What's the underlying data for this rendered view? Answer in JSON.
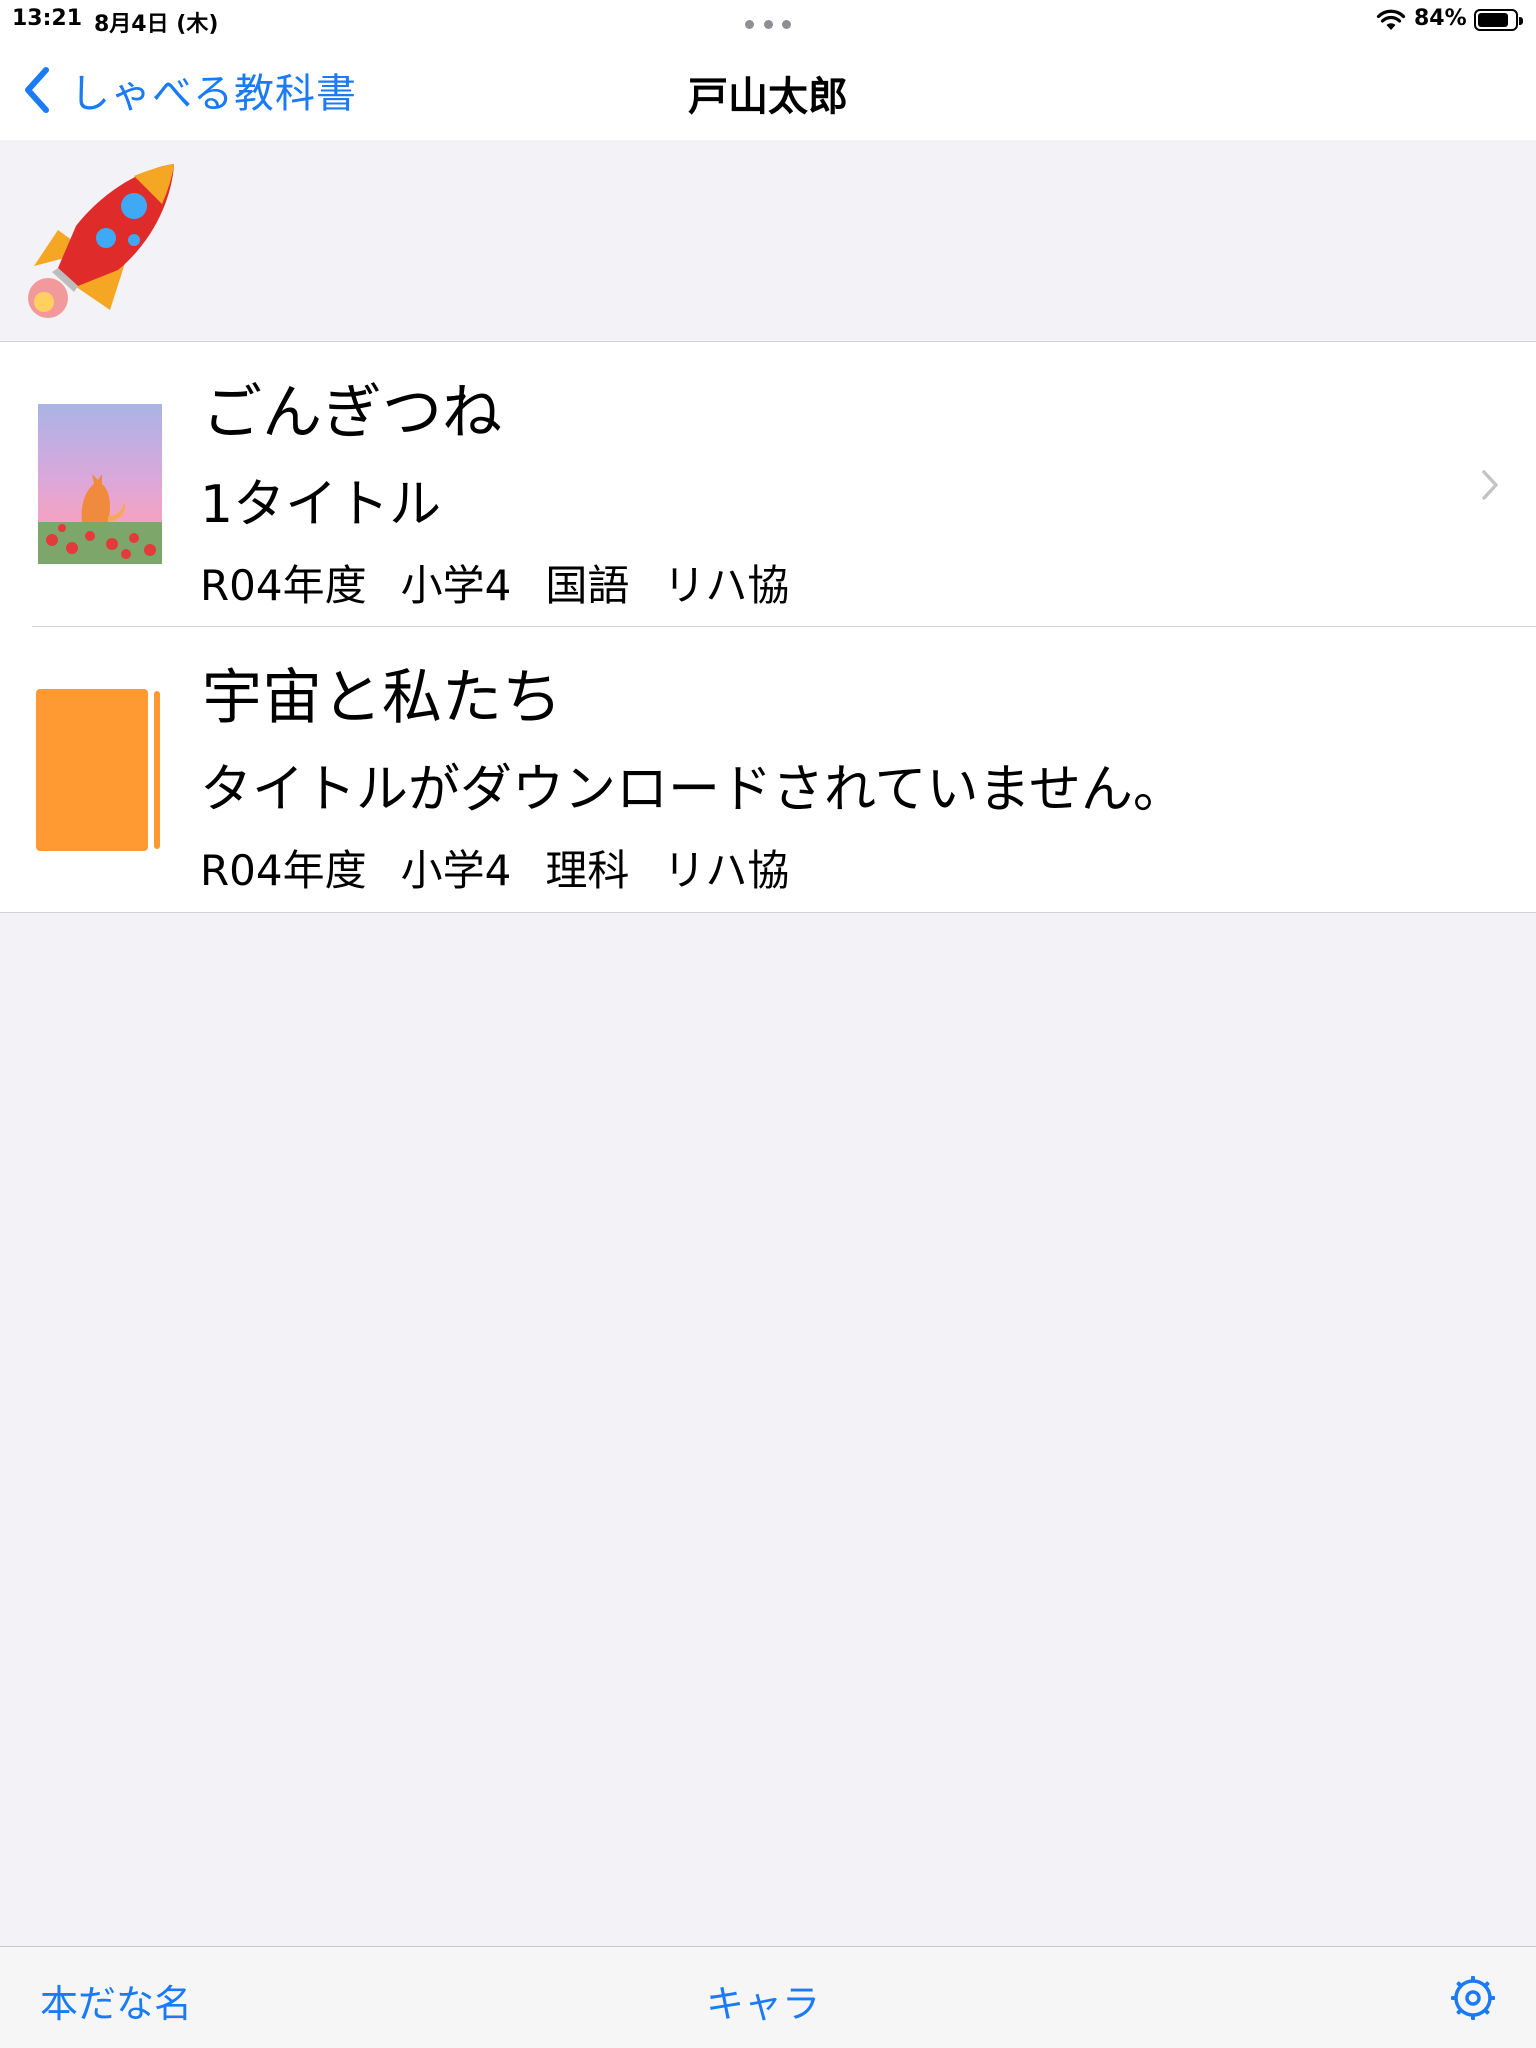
{
  "status_bar": {
    "time": "13:21",
    "date": "8月4日 (木)",
    "battery_percent": "84%",
    "battery_level": 0.84
  },
  "nav": {
    "back_label": "しゃべる教科書",
    "title": "戸山太郎"
  },
  "books": [
    {
      "title": "ごんぎつね",
      "subtitle": "1タイトル",
      "meta": [
        "R04年度",
        "小学4",
        "国語",
        "リハ協"
      ],
      "cover": "fox-illustration",
      "has_chevron": true
    },
    {
      "title": "宇宙と私たち",
      "subtitle": "タイトルがダウンロードされていません。",
      "meta": [
        "R04年度",
        "小学4",
        "理科",
        "リハ協"
      ],
      "cover": "orange-book-placeholder",
      "has_chevron": false
    }
  ],
  "toolbar": {
    "left_label": "本だな名",
    "center_label": "キャラ",
    "settings_icon": "gear-icon"
  },
  "colors": {
    "accent": "#1a7bf5",
    "background": "#f2f2f7",
    "book_orange": "#ff9a33"
  }
}
